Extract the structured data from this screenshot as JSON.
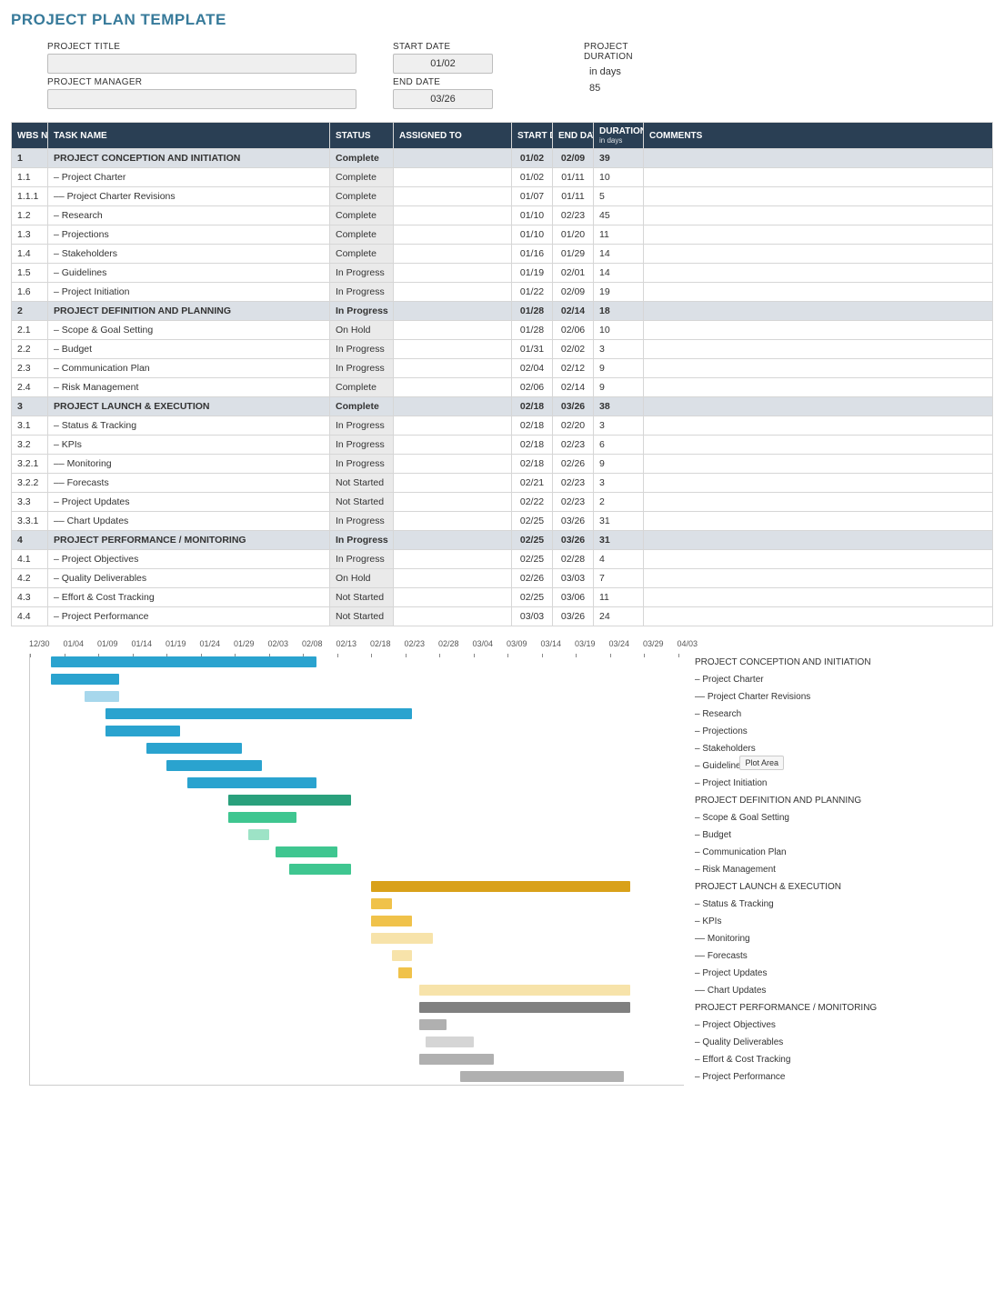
{
  "title": "PROJECT PLAN TEMPLATE",
  "header": {
    "project_title_label": "PROJECT TITLE",
    "project_title": "",
    "project_manager_label": "PROJECT MANAGER",
    "project_manager": "",
    "start_date_label": "START DATE",
    "start_date": "01/02",
    "end_date_label": "END DATE",
    "end_date": "03/26",
    "duration_label_1": "PROJECT",
    "duration_label_2": "DURATION",
    "duration_unit": "in days",
    "duration": "85"
  },
  "columns": {
    "wbs": "WBS NO.",
    "task": "TASK NAME",
    "status": "STATUS",
    "assigned": "ASSIGNED TO",
    "start": "START DATE",
    "end": "END DATE",
    "duration": "DURATION",
    "duration_sub": "in days",
    "comments": "COMMENTS"
  },
  "rows": [
    {
      "section": true,
      "wbs": "1",
      "task": "PROJECT CONCEPTION AND INITIATION",
      "status": "Complete",
      "assigned": "",
      "start": "01/02",
      "end": "02/09",
      "dur": "39",
      "comm": ""
    },
    {
      "wbs": "1.1",
      "task": "– Project Charter",
      "status": "Complete",
      "assigned": "",
      "start": "01/02",
      "end": "01/11",
      "dur": "10",
      "comm": ""
    },
    {
      "wbs": "1.1.1",
      "task": "–– Project Charter Revisions",
      "status": "Complete",
      "assigned": "",
      "start": "01/07",
      "end": "01/11",
      "dur": "5",
      "comm": ""
    },
    {
      "wbs": "1.2",
      "task": "– Research",
      "status": "Complete",
      "assigned": "",
      "start": "01/10",
      "end": "02/23",
      "dur": "45",
      "comm": ""
    },
    {
      "wbs": "1.3",
      "task": "– Projections",
      "status": "Complete",
      "assigned": "",
      "start": "01/10",
      "end": "01/20",
      "dur": "11",
      "comm": ""
    },
    {
      "wbs": "1.4",
      "task": "– Stakeholders",
      "status": "Complete",
      "assigned": "",
      "start": "01/16",
      "end": "01/29",
      "dur": "14",
      "comm": ""
    },
    {
      "wbs": "1.5",
      "task": "– Guidelines",
      "status": "In Progress",
      "assigned": "",
      "start": "01/19",
      "end": "02/01",
      "dur": "14",
      "comm": ""
    },
    {
      "wbs": "1.6",
      "task": "– Project Initiation",
      "status": "In Progress",
      "assigned": "",
      "start": "01/22",
      "end": "02/09",
      "dur": "19",
      "comm": ""
    },
    {
      "section": true,
      "wbs": "2",
      "task": "PROJECT DEFINITION AND PLANNING",
      "status": "In Progress",
      "assigned": "",
      "start": "01/28",
      "end": "02/14",
      "dur": "18",
      "comm": ""
    },
    {
      "wbs": "2.1",
      "task": "– Scope & Goal Setting",
      "status": "On Hold",
      "assigned": "",
      "start": "01/28",
      "end": "02/06",
      "dur": "10",
      "comm": ""
    },
    {
      "wbs": "2.2",
      "task": "– Budget",
      "status": "In Progress",
      "assigned": "",
      "start": "01/31",
      "end": "02/02",
      "dur": "3",
      "comm": ""
    },
    {
      "wbs": "2.3",
      "task": "– Communication Plan",
      "status": "In Progress",
      "assigned": "",
      "start": "02/04",
      "end": "02/12",
      "dur": "9",
      "comm": ""
    },
    {
      "wbs": "2.4",
      "task": "– Risk Management",
      "status": "Complete",
      "assigned": "",
      "start": "02/06",
      "end": "02/14",
      "dur": "9",
      "comm": ""
    },
    {
      "section": true,
      "wbs": "3",
      "task": "PROJECT LAUNCH & EXECUTION",
      "status": "Complete",
      "assigned": "",
      "start": "02/18",
      "end": "03/26",
      "dur": "38",
      "comm": ""
    },
    {
      "wbs": "3.1",
      "task": "– Status & Tracking",
      "status": "In Progress",
      "assigned": "",
      "start": "02/18",
      "end": "02/20",
      "dur": "3",
      "comm": ""
    },
    {
      "wbs": "3.2",
      "task": "– KPIs",
      "status": "In Progress",
      "assigned": "",
      "start": "02/18",
      "end": "02/23",
      "dur": "6",
      "comm": ""
    },
    {
      "wbs": "3.2.1",
      "task": "–– Monitoring",
      "status": "In Progress",
      "assigned": "",
      "start": "02/18",
      "end": "02/26",
      "dur": "9",
      "comm": ""
    },
    {
      "wbs": "3.2.2",
      "task": "–– Forecasts",
      "status": "Not Started",
      "assigned": "",
      "start": "02/21",
      "end": "02/23",
      "dur": "3",
      "comm": ""
    },
    {
      "wbs": "3.3",
      "task": "– Project Updates",
      "status": "Not Started",
      "assigned": "",
      "start": "02/22",
      "end": "02/23",
      "dur": "2",
      "comm": ""
    },
    {
      "wbs": "3.3.1",
      "task": "–– Chart Updates",
      "status": "In Progress",
      "assigned": "",
      "start": "02/25",
      "end": "03/26",
      "dur": "31",
      "comm": ""
    },
    {
      "section": true,
      "wbs": "4",
      "task": "PROJECT PERFORMANCE / MONITORING",
      "status": "In Progress",
      "assigned": "",
      "start": "02/25",
      "end": "03/26",
      "dur": "31",
      "comm": ""
    },
    {
      "wbs": "4.1",
      "task": "– Project Objectives",
      "status": "In Progress",
      "assigned": "",
      "start": "02/25",
      "end": "02/28",
      "dur": "4",
      "comm": ""
    },
    {
      "wbs": "4.2",
      "task": "– Quality Deliverables",
      "status": "On Hold",
      "assigned": "",
      "start": "02/26",
      "end": "03/03",
      "dur": "7",
      "comm": ""
    },
    {
      "wbs": "4.3",
      "task": "– Effort & Cost Tracking",
      "status": "Not Started",
      "assigned": "",
      "start": "02/25",
      "end": "03/06",
      "dur": "11",
      "comm": ""
    },
    {
      "wbs": "4.4",
      "task": "– Project Performance",
      "status": "Not Started",
      "assigned": "",
      "start": "03/03",
      "end": "03/26",
      "dur": "24",
      "comm": ""
    }
  ],
  "chart_data": {
    "type": "bar",
    "orientation": "horizontal-gantt",
    "x_axis_ticks": [
      "12/30",
      "01/04",
      "01/09",
      "01/14",
      "01/19",
      "01/24",
      "01/29",
      "02/03",
      "02/08",
      "02/13",
      "02/18",
      "02/23",
      "02/28",
      "03/04",
      "03/09",
      "03/14",
      "03/19",
      "03/24",
      "03/29",
      "04/03"
    ],
    "x_origin": "12/30",
    "x_unit": "days",
    "series": [
      {
        "name": "PROJECT CONCEPTION AND INITIATION",
        "start": "01/02",
        "end": "02/09",
        "start_offset_days": 3,
        "duration_days": 39,
        "color": "#2aa3cf"
      },
      {
        "name": "– Project Charter",
        "start": "01/02",
        "end": "01/11",
        "start_offset_days": 3,
        "duration_days": 10,
        "color": "#2aa3cf"
      },
      {
        "name": "–– Project Charter Revisions",
        "start": "01/07",
        "end": "01/11",
        "start_offset_days": 8,
        "duration_days": 5,
        "color": "#a7d7ec"
      },
      {
        "name": "– Research",
        "start": "01/10",
        "end": "02/23",
        "start_offset_days": 11,
        "duration_days": 45,
        "color": "#2aa3cf"
      },
      {
        "name": "– Projections",
        "start": "01/10",
        "end": "01/20",
        "start_offset_days": 11,
        "duration_days": 11,
        "color": "#2aa3cf"
      },
      {
        "name": "– Stakeholders",
        "start": "01/16",
        "end": "01/29",
        "start_offset_days": 17,
        "duration_days": 14,
        "color": "#2aa3cf"
      },
      {
        "name": "– Guidelines",
        "start": "01/19",
        "end": "02/01",
        "start_offset_days": 20,
        "duration_days": 14,
        "color": "#2aa3cf"
      },
      {
        "name": "– Project Initiation",
        "start": "01/22",
        "end": "02/09",
        "start_offset_days": 23,
        "duration_days": 19,
        "color": "#2aa3cf"
      },
      {
        "name": "PROJECT DEFINITION AND PLANNING",
        "start": "01/28",
        "end": "02/14",
        "start_offset_days": 29,
        "duration_days": 18,
        "color": "#2aa07c"
      },
      {
        "name": "– Scope & Goal Setting",
        "start": "01/28",
        "end": "02/06",
        "start_offset_days": 29,
        "duration_days": 10,
        "color": "#3fc690"
      },
      {
        "name": "– Budget",
        "start": "01/31",
        "end": "02/02",
        "start_offset_days": 32,
        "duration_days": 3,
        "color": "#9de3c6"
      },
      {
        "name": "– Communication Plan",
        "start": "02/04",
        "end": "02/12",
        "start_offset_days": 36,
        "duration_days": 9,
        "color": "#3fc690"
      },
      {
        "name": "– Risk Management",
        "start": "02/06",
        "end": "02/14",
        "start_offset_days": 38,
        "duration_days": 9,
        "color": "#3fc690"
      },
      {
        "name": "PROJECT LAUNCH & EXECUTION",
        "start": "02/18",
        "end": "03/26",
        "start_offset_days": 50,
        "duration_days": 38,
        "color": "#d9a11a"
      },
      {
        "name": "– Status & Tracking",
        "start": "02/18",
        "end": "02/20",
        "start_offset_days": 50,
        "duration_days": 3,
        "color": "#f0c24a"
      },
      {
        "name": "– KPIs",
        "start": "02/18",
        "end": "02/23",
        "start_offset_days": 50,
        "duration_days": 6,
        "color": "#f0c24a"
      },
      {
        "name": "–– Monitoring",
        "start": "02/18",
        "end": "02/26",
        "start_offset_days": 50,
        "duration_days": 9,
        "color": "#f7e3aa"
      },
      {
        "name": "–– Forecasts",
        "start": "02/21",
        "end": "02/23",
        "start_offset_days": 53,
        "duration_days": 3,
        "color": "#f7e3aa"
      },
      {
        "name": "– Project Updates",
        "start": "02/22",
        "end": "02/23",
        "start_offset_days": 54,
        "duration_days": 2,
        "color": "#f0c24a"
      },
      {
        "name": "–– Chart Updates",
        "start": "02/25",
        "end": "03/26",
        "start_offset_days": 57,
        "duration_days": 31,
        "color": "#f7e3aa"
      },
      {
        "name": "PROJECT PERFORMANCE / MONITORING",
        "start": "02/25",
        "end": "03/26",
        "start_offset_days": 57,
        "duration_days": 31,
        "color": "#808080"
      },
      {
        "name": "– Project Objectives",
        "start": "02/25",
        "end": "02/28",
        "start_offset_days": 57,
        "duration_days": 4,
        "color": "#b0b0b0"
      },
      {
        "name": "– Quality Deliverables",
        "start": "02/26",
        "end": "03/03",
        "start_offset_days": 58,
        "duration_days": 7,
        "color": "#d5d5d5"
      },
      {
        "name": "– Effort & Cost Tracking",
        "start": "02/25",
        "end": "03/06",
        "start_offset_days": 57,
        "duration_days": 11,
        "color": "#b0b0b0"
      },
      {
        "name": "– Project Performance",
        "start": "03/03",
        "end": "03/26",
        "start_offset_days": 63,
        "duration_days": 24,
        "color": "#b0b0b0"
      }
    ],
    "tooltip": "Plot Area"
  },
  "gantt_legend_entries": [
    "PROJECT CONCEPTION AND INITIATION",
    "– Project Charter",
    "–– Project Charter Revisions",
    "– Research",
    "– Projections",
    "– Stakeholders",
    "– Guidelines",
    "– Project Initiation",
    "PROJECT DEFINITION AND PLANNING",
    "– Scope & Goal Setting",
    "– Budget",
    "– Communication Plan",
    "– Risk Management",
    "PROJECT LAUNCH & EXECUTION",
    "– Status & Tracking",
    "– KPIs",
    "–– Monitoring",
    "–– Forecasts",
    "– Project Updates",
    "–– Chart Updates",
    "PROJECT PERFORMANCE / MONITORING",
    "– Project Objectives",
    "– Quality Deliverables",
    "– Effort & Cost Tracking",
    "– Project Performance"
  ]
}
